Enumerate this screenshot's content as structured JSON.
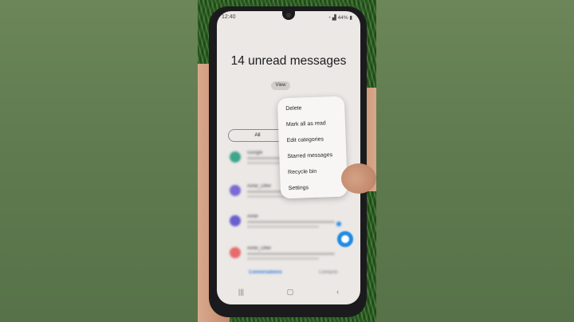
{
  "status_bar": {
    "time": "12:40",
    "battery": "44%"
  },
  "inbox": {
    "headline": "14 unread messages",
    "view_button": "View",
    "tab_all": "All"
  },
  "menu": {
    "items": [
      "Delete",
      "Mark all as read",
      "Edit categories",
      "Starred messages",
      "Recycle bin",
      "Settings"
    ]
  },
  "conversations": [
    {
      "sender": "Google",
      "color": "#3ea58a"
    },
    {
      "sender": "Airtel_Offer",
      "color": "#7a6ad4"
    },
    {
      "sender": "Airtel",
      "color": "#6a5fce"
    },
    {
      "sender": "Airtel_Offer",
      "color": "#e66c6c"
    }
  ],
  "bottom_tabs": {
    "left": "Conversations",
    "right": "Contacts"
  }
}
